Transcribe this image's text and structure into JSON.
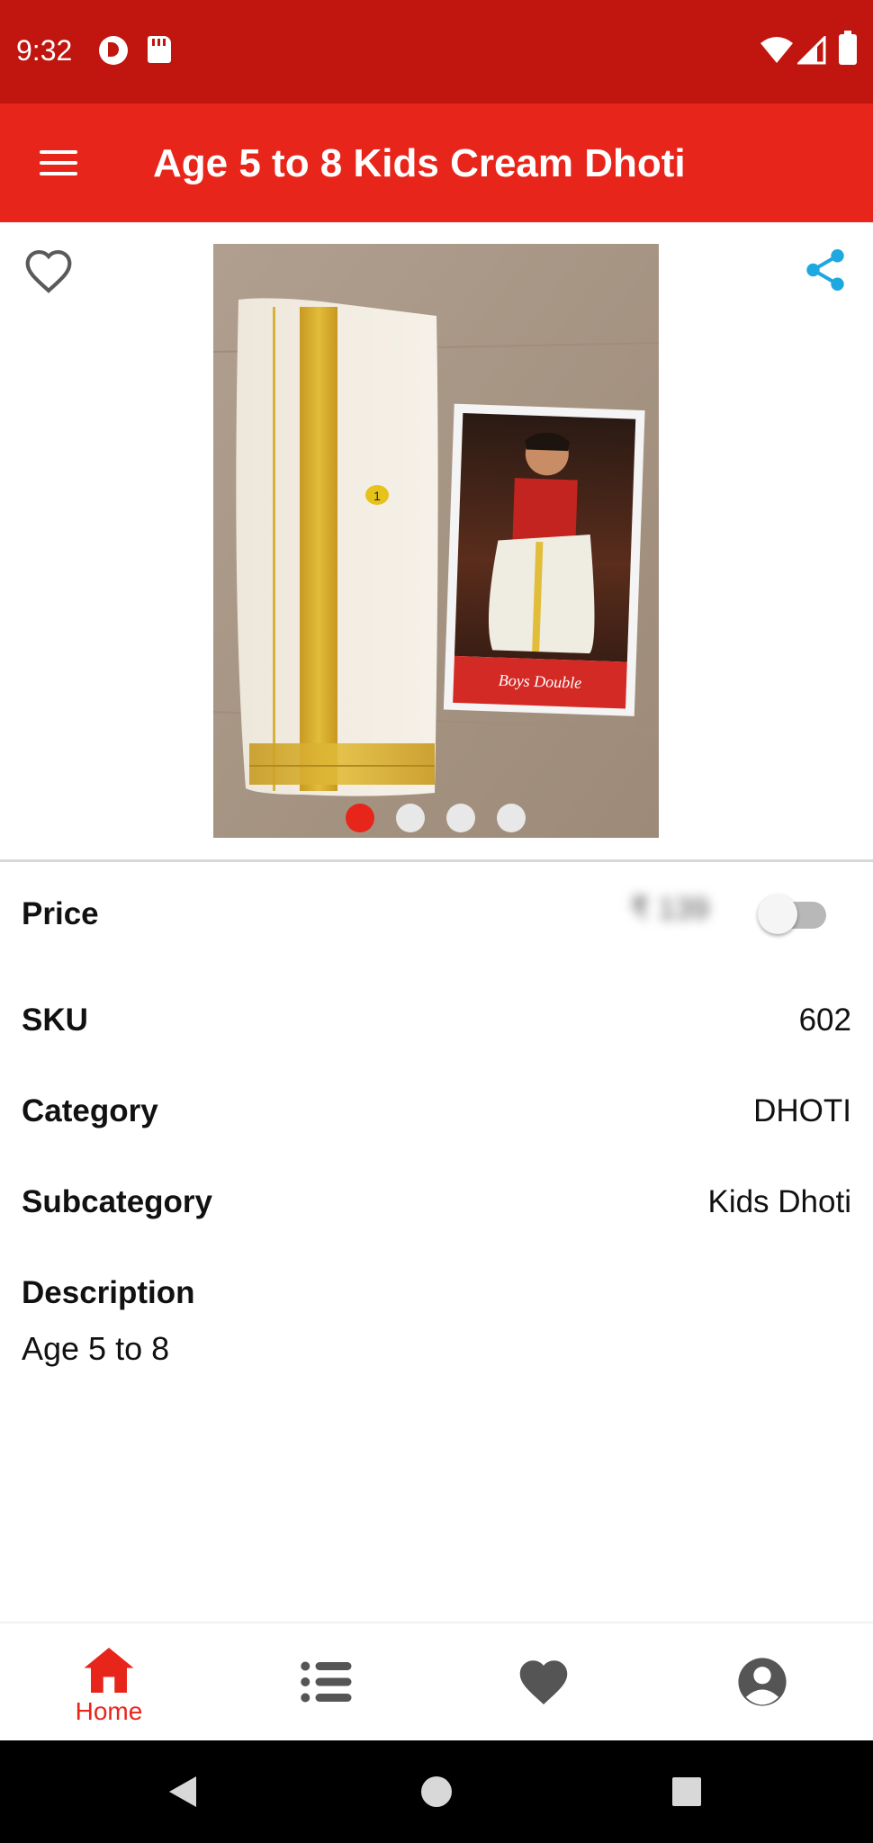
{
  "status_bar": {
    "time": "9:32",
    "icons": [
      "app-notification-icon",
      "sd-card-icon",
      "wifi-icon",
      "signal-icon",
      "battery-icon"
    ]
  },
  "app_bar": {
    "title": "Age 5 to 8 Kids Cream Dhoti",
    "menu_icon": "hamburger-menu-icon",
    "background": "#e8251b"
  },
  "product_image": {
    "favorite_icon": "heart-outline-icon",
    "share_icon": "share-icon",
    "card_caption": "Boys Double",
    "tag_number": "1",
    "carousel_count": 4,
    "carousel_active_index": 0
  },
  "details": {
    "price": {
      "label": "Price",
      "value": "₹ 139",
      "toggle_on": false
    },
    "sku": {
      "label": "SKU",
      "value": "602"
    },
    "category": {
      "label": "Category",
      "value": "DHOTI"
    },
    "subcategory": {
      "label": "Subcategory",
      "value": "Kids Dhoti"
    },
    "description": {
      "label": "Description",
      "value": "Age 5 to 8"
    }
  },
  "bottom_nav": {
    "items": [
      {
        "label": "Home",
        "icon": "home-icon",
        "active": true
      },
      {
        "label": "",
        "icon": "list-icon",
        "active": false
      },
      {
        "label": "",
        "icon": "heart-icon",
        "active": false
      },
      {
        "label": "",
        "icon": "account-icon",
        "active": false
      }
    ]
  },
  "colors": {
    "accent": "#e8251b",
    "status_bar": "#c0160f",
    "share": "#1ea8e0",
    "nav_inactive": "#555555"
  }
}
